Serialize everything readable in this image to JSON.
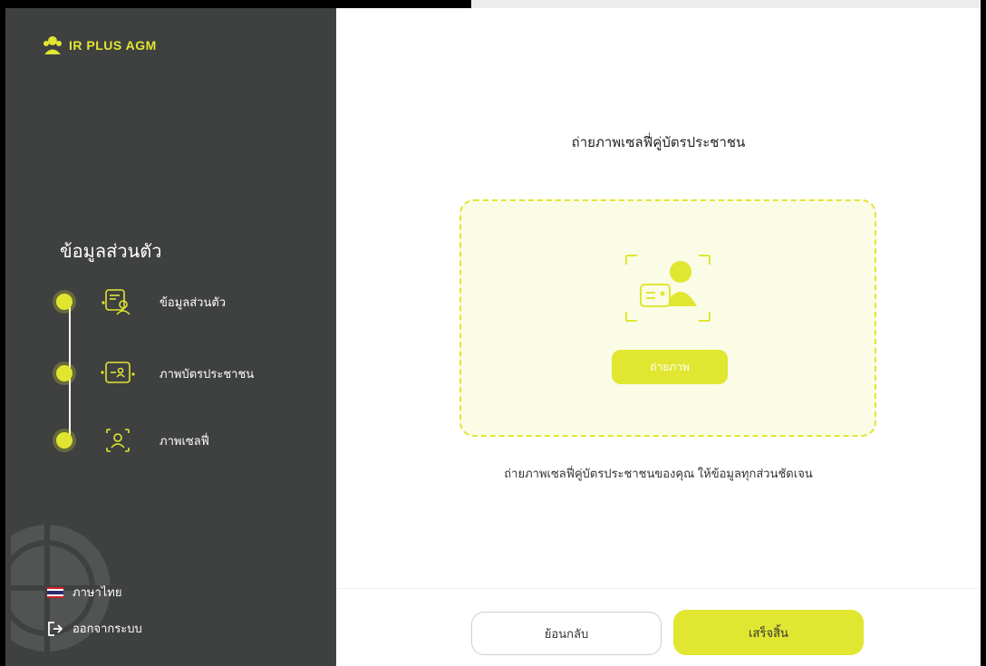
{
  "app": {
    "logo_text": "IR PLUS AGM"
  },
  "sidebar": {
    "section_title": "ข้อมูลส่วนตัว",
    "steps": [
      {
        "label": "ข้อมูลส่วนตัว",
        "icon": "profile-card-icon"
      },
      {
        "label": "ภาพบัตรประชาชน",
        "icon": "id-card-icon"
      },
      {
        "label": "ภาพเซลฟี่",
        "icon": "selfie-frame-icon"
      }
    ],
    "language_label": "ภาษาไทย",
    "logout_label": "ออกจากระบบ"
  },
  "main": {
    "title": "ถ่ายภาพเซลฟี่คู่บัตรประชาชน",
    "capture_button": "ถ่ายภาพ",
    "instruction": "ถ่ายภาพเซลฟี่คู่บัตรประชาชนของคุณ ให้ข้อมูลทุกส่วนชัดเจน"
  },
  "footer": {
    "back_label": "ย้อนกลับ",
    "finish_label": "เสร็จสิ้น"
  },
  "colors": {
    "accent": "#e1e631",
    "sidebar_bg": "#3f4040",
    "capture_bg": "#fafce6"
  }
}
